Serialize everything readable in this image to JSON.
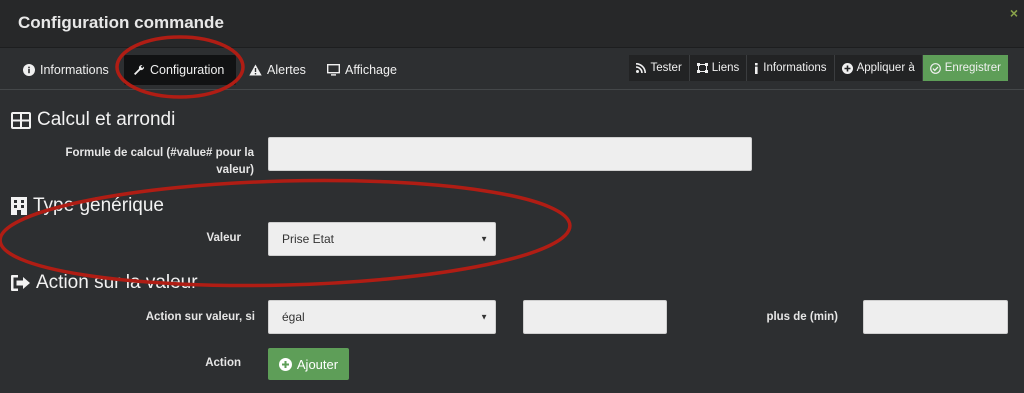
{
  "modal": {
    "title": "Configuration commande",
    "close_symbol": "×"
  },
  "tabs": [
    {
      "label": "Informations",
      "icon": "info-circle-icon"
    },
    {
      "label": "Configuration",
      "icon": "wrench-icon",
      "active": true
    },
    {
      "label": "Alertes",
      "icon": "warning-icon"
    },
    {
      "label": "Affichage",
      "icon": "monitor-icon"
    }
  ],
  "toolbar": {
    "test_label": "Tester",
    "links_label": "Liens",
    "info_label": "Informations",
    "apply_label": "Appliquer à",
    "save_label": "Enregistrer"
  },
  "sections": {
    "calc": {
      "title": "Calcul et arrondi",
      "formula_label": "Formule de calcul (#value# pour la valeur)",
      "formula_value": ""
    },
    "generic": {
      "title": "Type générique",
      "value_label": "Valeur",
      "value_selected": "Prise Etat"
    },
    "action": {
      "title": "Action sur la valeur",
      "condition_label": "Action sur valeur, si",
      "condition_selected": "égal",
      "condition_value": "",
      "duration_label": "plus de (min)",
      "duration_value": "",
      "action_label": "Action",
      "add_label": "Ajouter"
    }
  },
  "colors": {
    "background": "#2d2f31",
    "titlebar": "#272829",
    "active_tab": "#111213",
    "success": "#5e9e58",
    "annotation": "#b01d14"
  }
}
